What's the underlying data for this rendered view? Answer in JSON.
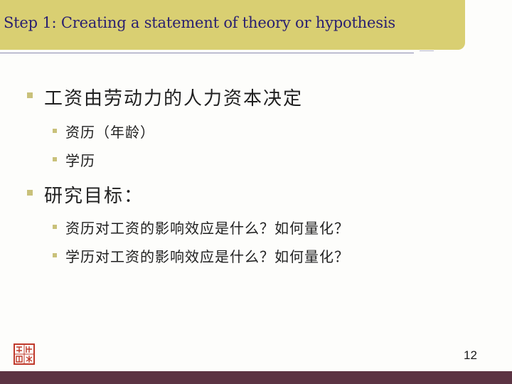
{
  "slide": {
    "title": "Step 1: Creating a statement of theory or hypothesis",
    "page_number": "12"
  },
  "content": {
    "bullets": [
      {
        "text": "工资由劳动力的人力资本决定",
        "sub": [
          {
            "text": "资历（年龄）"
          },
          {
            "text": "学历"
          }
        ]
      },
      {
        "text": "研究目标：",
        "sub": [
          {
            "text": "资历对工资的影响效应是什么？如何量化？"
          },
          {
            "text": "学历对工资的影响效应是什么？如何量化？"
          }
        ]
      }
    ]
  },
  "colors": {
    "title_bar": "#d9cf72",
    "title_text": "#2a2070",
    "bullet": "#c9c17a",
    "bottom_bar": "#5c3343",
    "seal": "#c0392b"
  }
}
